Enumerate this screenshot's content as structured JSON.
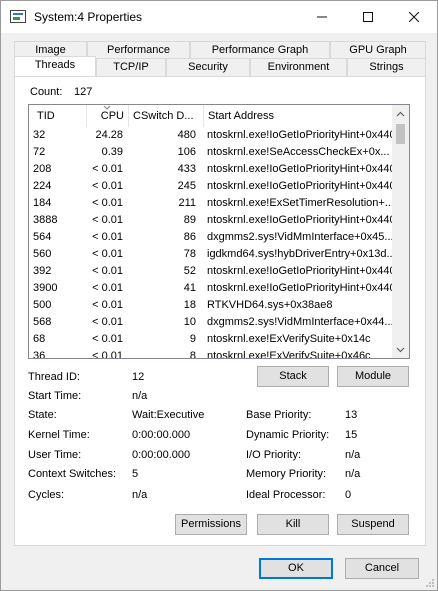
{
  "window": {
    "title": "System:4 Properties",
    "minimize_glyph": "—",
    "maximize_glyph": "□",
    "close_glyph": "✕"
  },
  "tabs": {
    "row1": [
      "Image",
      "Performance",
      "Performance Graph",
      "GPU Graph"
    ],
    "row2": [
      "Threads",
      "TCP/IP",
      "Security",
      "Environment",
      "Strings"
    ],
    "active": "Threads"
  },
  "count": {
    "label": "Count:",
    "value": "127"
  },
  "columns": {
    "tid": "TID",
    "cpu": "CPU",
    "cswitch": "CSwitch D...",
    "start": "Start Address"
  },
  "threads": [
    {
      "tid": "32",
      "cpu": "24.28",
      "cswitch": "480",
      "start": "ntoskrnl.exe!IoGetIoPriorityHint+0x440"
    },
    {
      "tid": "72",
      "cpu": "0.39",
      "cswitch": "106",
      "start": "ntoskrnl.exe!SeAccessCheckEx+0x..."
    },
    {
      "tid": "208",
      "cpu": "< 0.01",
      "cswitch": "433",
      "start": "ntoskrnl.exe!IoGetIoPriorityHint+0x440"
    },
    {
      "tid": "224",
      "cpu": "< 0.01",
      "cswitch": "245",
      "start": "ntoskrnl.exe!IoGetIoPriorityHint+0x440"
    },
    {
      "tid": "184",
      "cpu": "< 0.01",
      "cswitch": "211",
      "start": "ntoskrnl.exe!ExSetTimerResolution+..."
    },
    {
      "tid": "3888",
      "cpu": "< 0.01",
      "cswitch": "89",
      "start": "ntoskrnl.exe!IoGetIoPriorityHint+0x440"
    },
    {
      "tid": "564",
      "cpu": "< 0.01",
      "cswitch": "86",
      "start": "dxgmms2.sys!VidMmInterface+0x45..."
    },
    {
      "tid": "560",
      "cpu": "< 0.01",
      "cswitch": "78",
      "start": "igdkmd64.sys!hybDriverEntry+0x13d..."
    },
    {
      "tid": "392",
      "cpu": "< 0.01",
      "cswitch": "52",
      "start": "ntoskrnl.exe!IoGetIoPriorityHint+0x440"
    },
    {
      "tid": "3900",
      "cpu": "< 0.01",
      "cswitch": "41",
      "start": "ntoskrnl.exe!IoGetIoPriorityHint+0x440"
    },
    {
      "tid": "500",
      "cpu": "< 0.01",
      "cswitch": "18",
      "start": "RTKVHD64.sys+0x38ae8"
    },
    {
      "tid": "568",
      "cpu": "< 0.01",
      "cswitch": "10",
      "start": "dxgmms2.sys!VidMmInterface+0x44..."
    },
    {
      "tid": "68",
      "cpu": "< 0.01",
      "cswitch": "9",
      "start": "ntoskrnl.exe!ExVerifySuite+0x14c"
    },
    {
      "tid": "36",
      "cpu": "< 0.01",
      "cswitch": "8",
      "start": "ntoskrnl.exe!ExVerifySuite+0x46c"
    }
  ],
  "details": {
    "thread_id_label": "Thread ID:",
    "thread_id": "12",
    "start_time_label": "Start Time:",
    "start_time": "n/a",
    "state_label": "State:",
    "state": "Wait:Executive",
    "kernel_time_label": "Kernel Time:",
    "kernel_time": "0:00:00.000",
    "user_time_label": "User Time:",
    "user_time": "0:00:00.000",
    "ctx_label": "Context Switches:",
    "ctx": "5",
    "cycles_label": "Cycles:",
    "cycles": "n/a",
    "base_priority_label": "Base Priority:",
    "base_priority": "13",
    "dynamic_priority_label": "Dynamic Priority:",
    "dynamic_priority": "15",
    "io_priority_label": "I/O Priority:",
    "io_priority": "n/a",
    "memory_priority_label": "Memory Priority:",
    "memory_priority": "n/a",
    "ideal_processor_label": "Ideal Processor:",
    "ideal_processor": "0"
  },
  "buttons": {
    "stack": "Stack",
    "module": "Module",
    "permissions": "Permissions",
    "kill": "Kill",
    "suspend": "Suspend",
    "ok": "OK",
    "cancel": "Cancel"
  },
  "colors": {
    "accent": "#0078d7",
    "tab_border": "#d9d9d9"
  }
}
